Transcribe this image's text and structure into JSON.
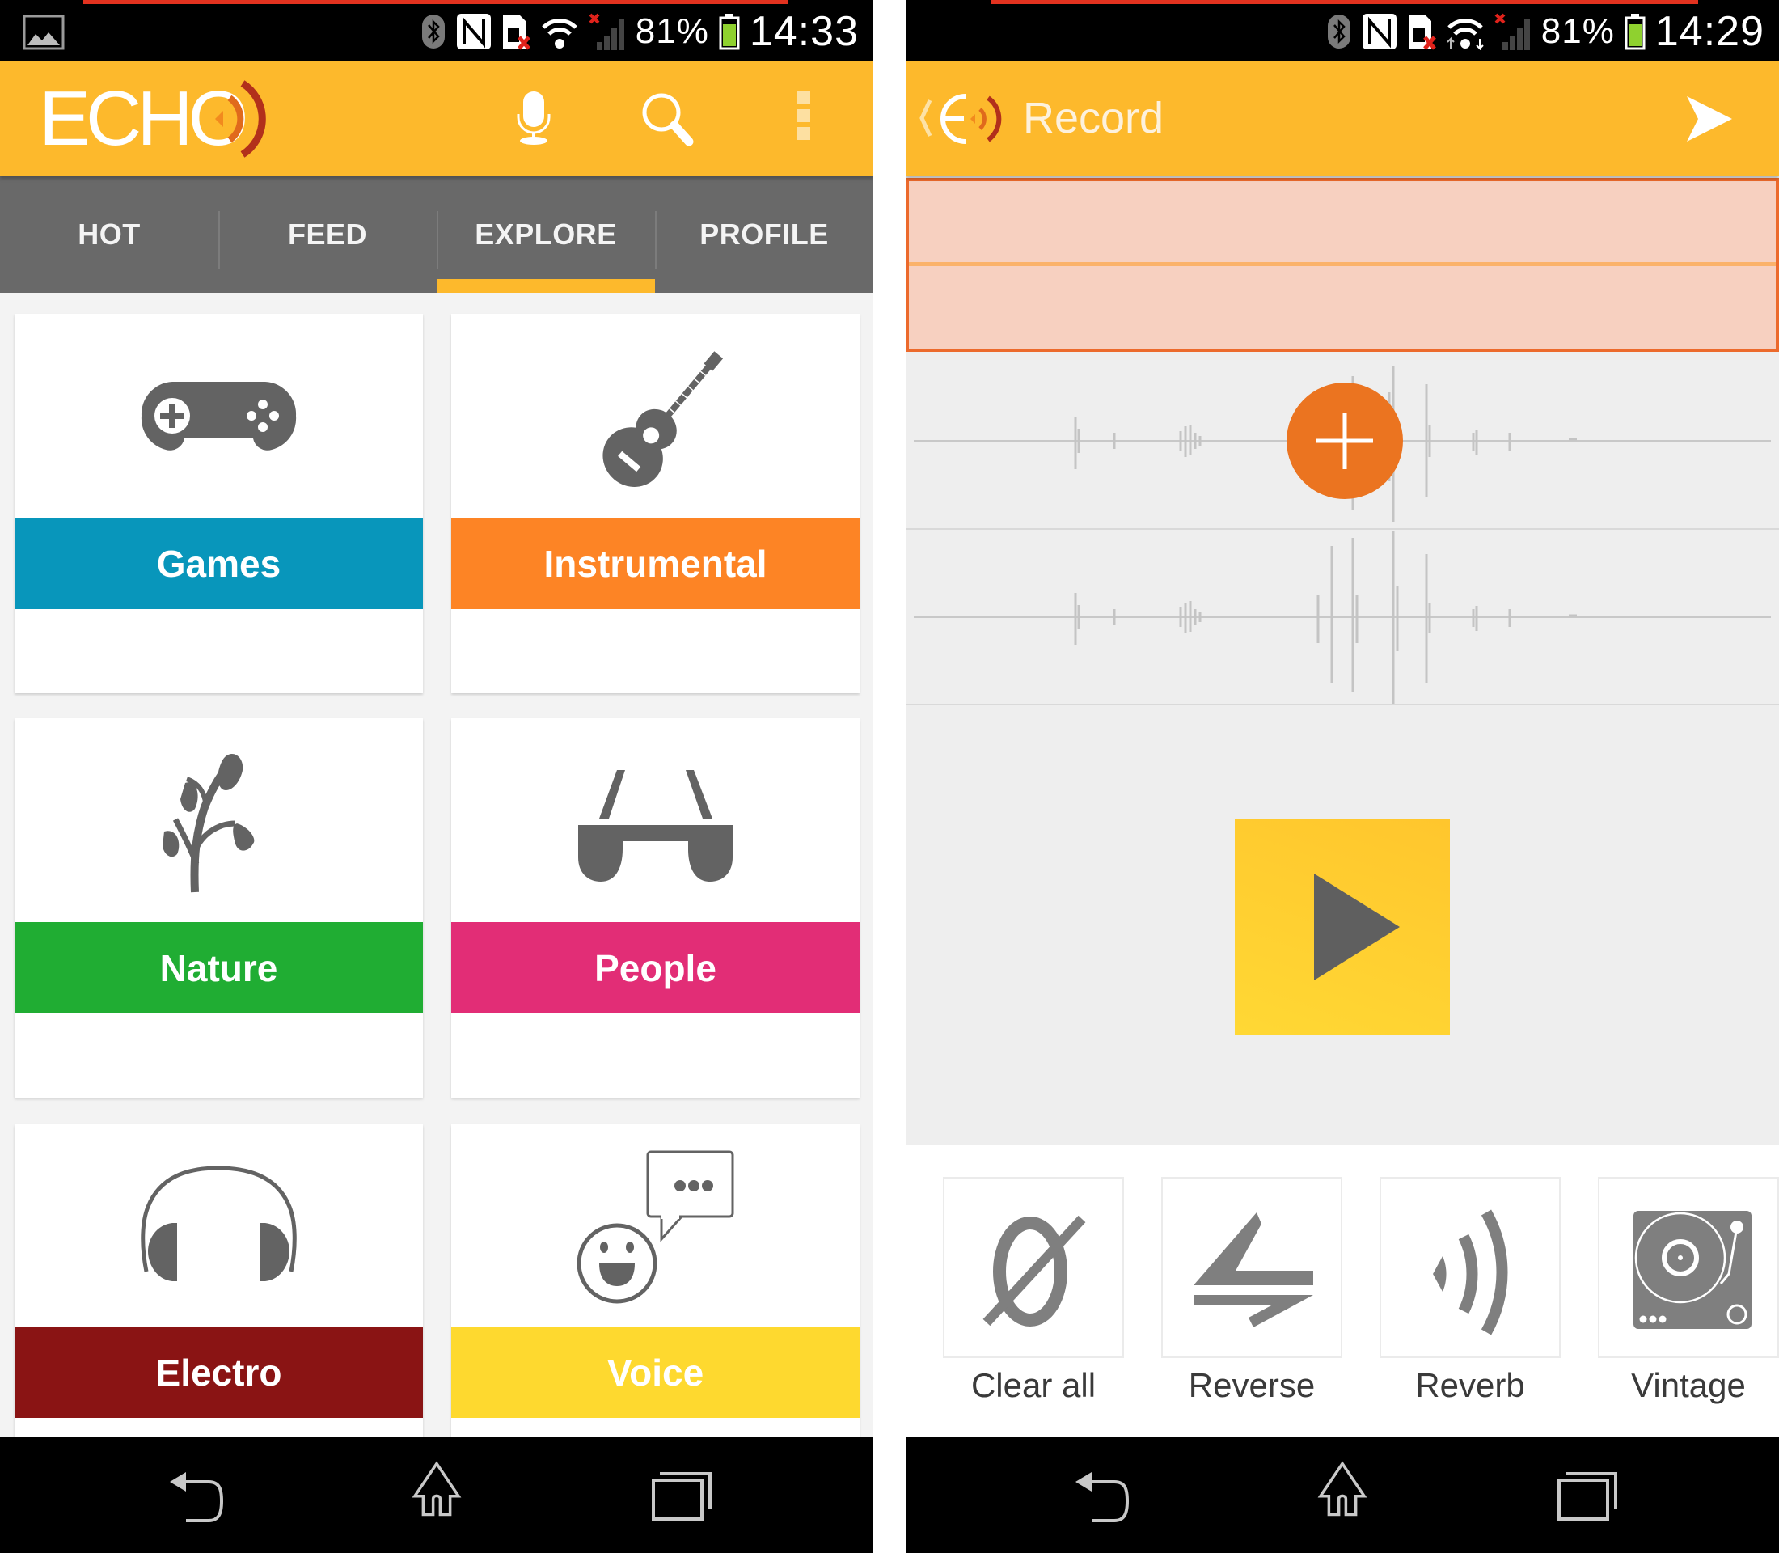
{
  "left_screen": {
    "status_bar": {
      "icons": [
        "gallery-notification-icon",
        "bluetooth-icon",
        "nfc-icon",
        "no-sim-icon",
        "wifi-icon",
        "signal-no-service-icon",
        "battery-icon"
      ],
      "battery": "81%",
      "time": "14:33"
    },
    "app_bar": {
      "logo_text": "ECHO",
      "actions": [
        "microphone-icon",
        "search-icon",
        "overflow-menu-icon"
      ]
    },
    "tabs": [
      {
        "label": "HOT",
        "active": false
      },
      {
        "label": "FEED",
        "active": false
      },
      {
        "label": "EXPLORE",
        "active": true
      },
      {
        "label": "PROFILE",
        "active": false
      }
    ],
    "categories": [
      {
        "label": "Games",
        "icon": "gamepad-icon",
        "color": "#0896bb"
      },
      {
        "label": "Instrumental",
        "icon": "guitar-icon",
        "color": "#fd8425"
      },
      {
        "label": "Nature",
        "icon": "plant-icon",
        "color": "#20ad33"
      },
      {
        "label": "People",
        "icon": "sunglasses-icon",
        "color": "#e22d76"
      },
      {
        "label": "Electro",
        "icon": "headphones-icon",
        "color": "#8a1414"
      },
      {
        "label": "Voice",
        "icon": "talking-face-icon",
        "color": "#fed92f"
      }
    ],
    "nav_bar": [
      "back-icon",
      "home-icon",
      "recent-apps-icon"
    ]
  },
  "right_screen": {
    "status_bar": {
      "icons": [
        "bluetooth-icon",
        "nfc-icon",
        "no-sim-icon",
        "wifi-data-icon",
        "signal-no-service-icon",
        "battery-icon"
      ],
      "battery": "81%",
      "time": "14:29"
    },
    "app_bar": {
      "title": "Record",
      "actions": [
        "send-icon"
      ]
    },
    "tracks": [
      {
        "name": "selected-empty-track"
      },
      {
        "name": "track-1"
      },
      {
        "name": "track-2"
      }
    ],
    "add_button": "add-track-icon",
    "play_button": "play-icon",
    "effects": [
      {
        "label": "Clear all",
        "icon": "clear-all-icon"
      },
      {
        "label": "Reverse",
        "icon": "reverse-icon"
      },
      {
        "label": "Reverb",
        "icon": "reverb-icon"
      },
      {
        "label": "Vintage",
        "icon": "turntable-icon"
      }
    ],
    "nav_bar": [
      "back-icon",
      "home-icon",
      "recent-apps-icon"
    ]
  },
  "colors": {
    "primary": "#fdb92c",
    "tab_bar": "#696969",
    "accent_orange": "#eb7420",
    "selection": "#f7d0c0",
    "icon_gray": "#636363"
  }
}
